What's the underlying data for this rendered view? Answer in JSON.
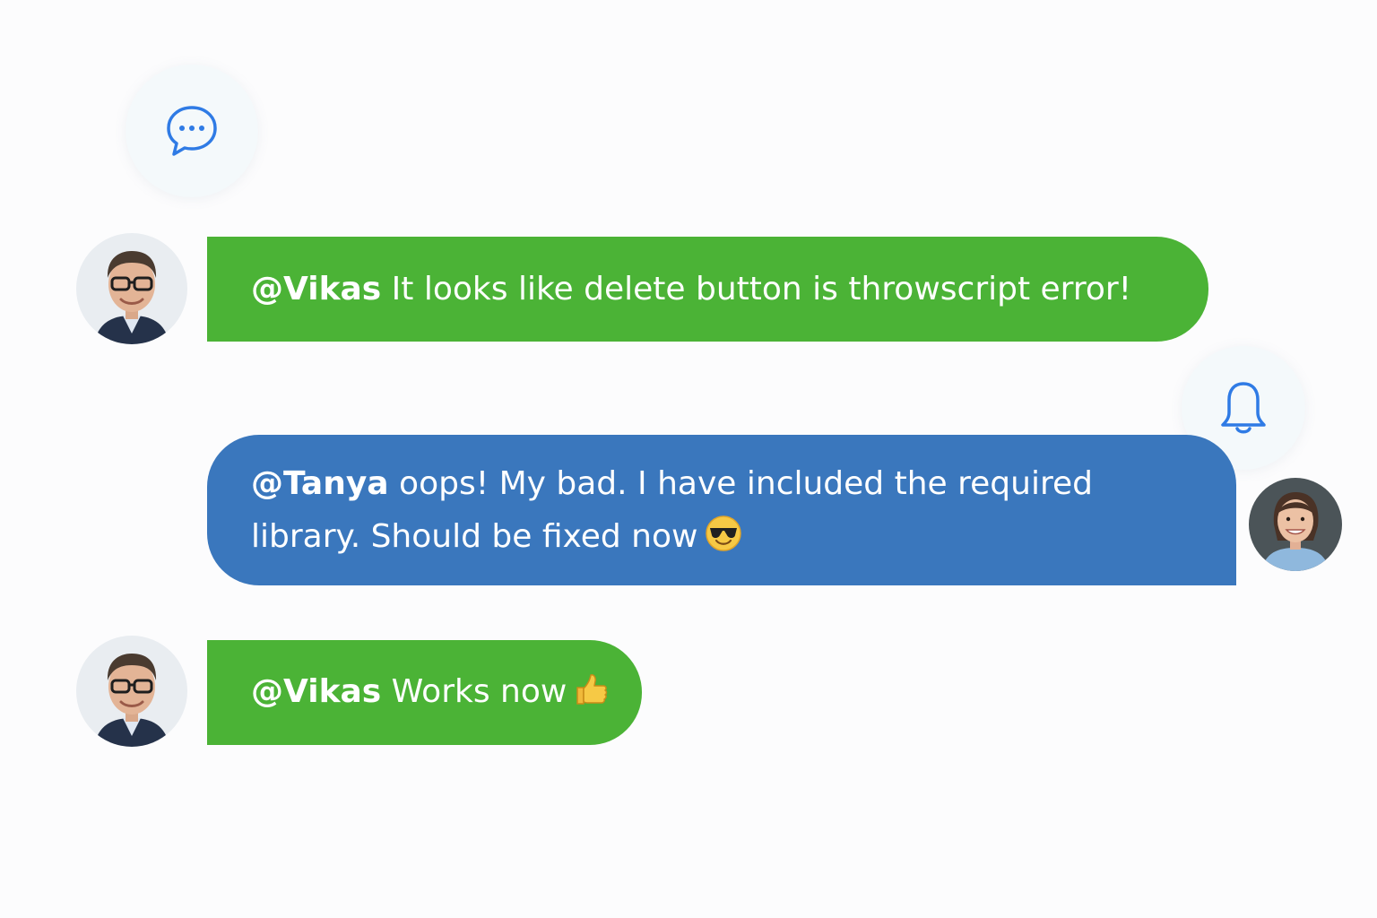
{
  "icons": {
    "top_badge": "chat-bubble-dots-icon",
    "side_badge": "bell-icon",
    "accent_color": "#2f7be5"
  },
  "messages": [
    {
      "sender_avatar": "man-with-glasses-avatar",
      "mention": "@Vikas",
      "text": " It looks like delete button is throwscript error!",
      "color": "#4bb336",
      "align": "left"
    },
    {
      "sender_avatar": "woman-avatar",
      "mention": "@Tanya",
      "text_line1": " oops! My bad. I have included the required",
      "text_line2": "library. Should be fixed now",
      "emoji": "sunglasses-face-emoji",
      "color": "#3a77bd",
      "align": "right"
    },
    {
      "sender_avatar": "man-with-glasses-avatar",
      "mention": "@Vikas",
      "text": " Works now",
      "emoji": "thumbs-up-emoji",
      "color": "#4bb336",
      "align": "left"
    }
  ]
}
